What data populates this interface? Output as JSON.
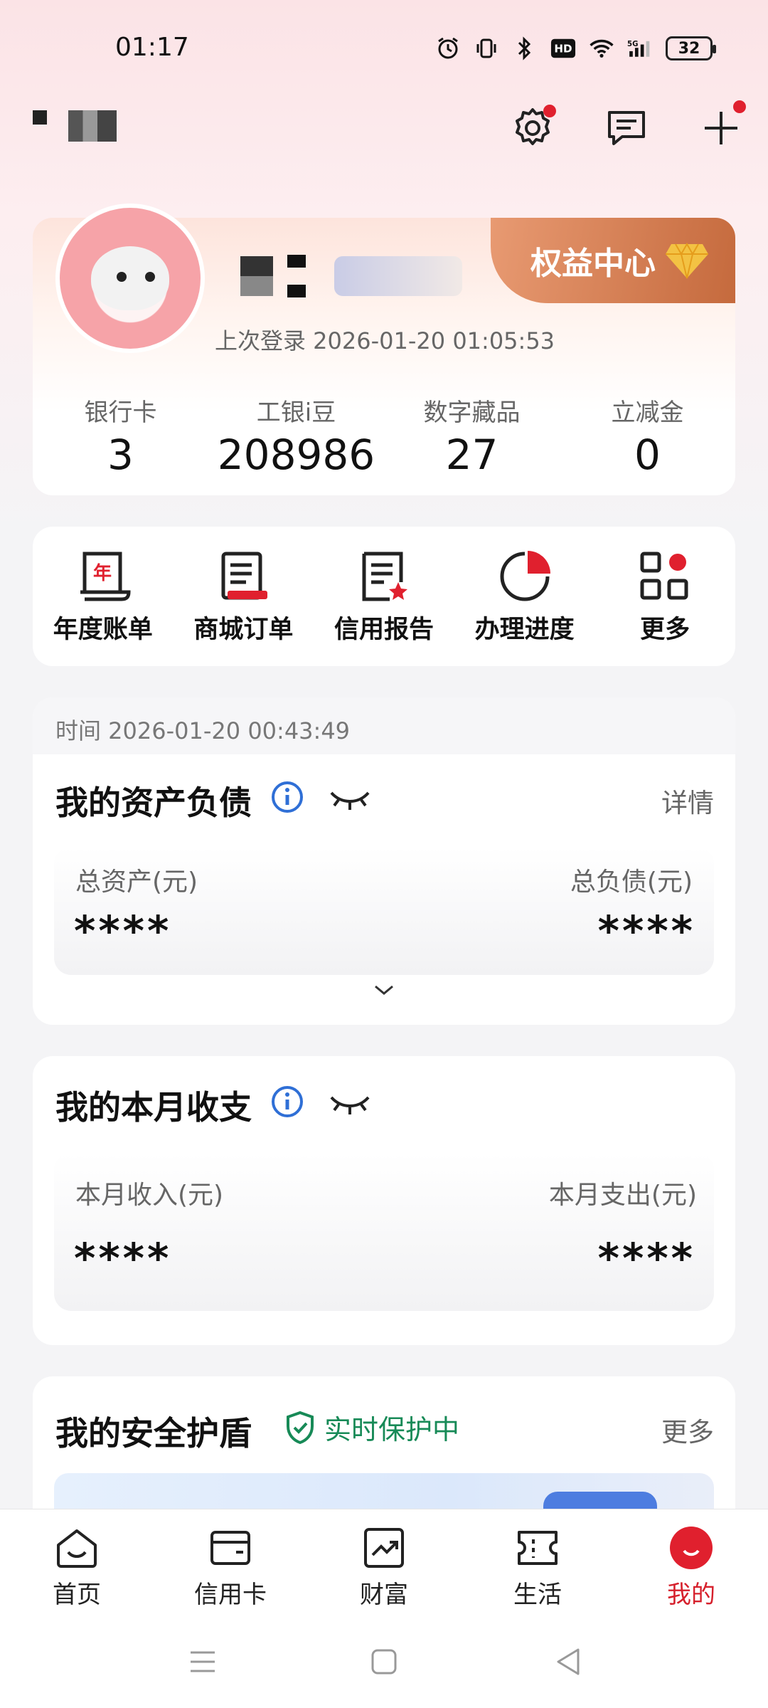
{
  "status_bar": {
    "time": "01:17",
    "battery": "32"
  },
  "header": {
    "user_name_masked": ""
  },
  "profile": {
    "last_login": "上次登录 2026-01-20 01:05:53",
    "rights_center": "权益中心",
    "stats": [
      {
        "label": "银行卡",
        "value": "3"
      },
      {
        "label": "工银i豆",
        "value": "208986"
      },
      {
        "label": "数字藏品",
        "value": "27"
      },
      {
        "label": "立减金",
        "value": "0"
      }
    ]
  },
  "quick_actions": [
    {
      "label": "年度账单",
      "icon": "annual-bill-icon"
    },
    {
      "label": "商城订单",
      "icon": "mall-order-icon"
    },
    {
      "label": "信用报告",
      "icon": "credit-report-icon"
    },
    {
      "label": "办理进度",
      "icon": "progress-icon"
    },
    {
      "label": "更多",
      "icon": "more-grid-icon"
    }
  ],
  "assets": {
    "time": "时间 2026-01-20 00:43:49",
    "title": "我的资产负债",
    "detail": "详情",
    "total_assets_label": "总资产(元)",
    "total_assets_value": "****",
    "total_liab_label": "总负债(元)",
    "total_liab_value": "****"
  },
  "monthly": {
    "title": "我的本月收支",
    "income_label": "本月收入(元)",
    "income_value": "****",
    "expense_label": "本月支出(元)",
    "expense_value": "****"
  },
  "shield": {
    "title": "我的安全护盾",
    "status": "实时保护中",
    "more": "更多"
  },
  "bottom_nav": [
    {
      "label": "首页",
      "icon": "home-icon"
    },
    {
      "label": "信用卡",
      "icon": "credit-card-icon"
    },
    {
      "label": "财富",
      "icon": "wealth-icon"
    },
    {
      "label": "生活",
      "icon": "life-ticket-icon"
    },
    {
      "label": "我的",
      "icon": "me-icon",
      "active": true
    }
  ],
  "colors": {
    "accent": "#d6202c",
    "green": "#178a57",
    "info_blue": "#2f6fd6",
    "rights_bg": "#c56a3d"
  }
}
